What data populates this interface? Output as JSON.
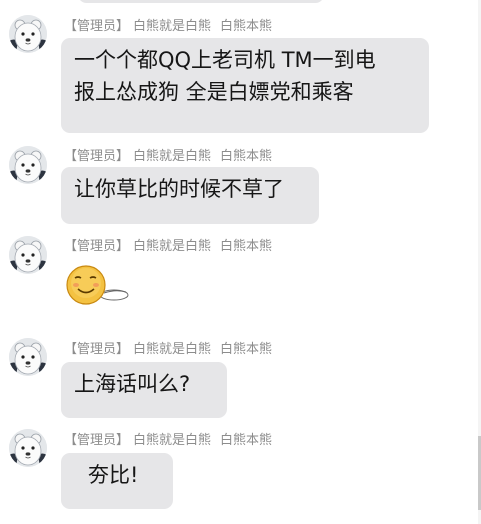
{
  "messages": [
    {
      "role": "【管理员】",
      "nickname": "白熊就是白熊",
      "title_tag": "白熊本熊",
      "text_lines": [
        "一个个都QQ上老司机  TM一到电",
        "报上怂成狗 全是白嫖党和乘客"
      ]
    },
    {
      "role": "【管理员】",
      "nickname": "白熊就是白熊",
      "title_tag": "白熊本熊",
      "text": "让你草比的时候不草了"
    },
    {
      "role": "【管理员】",
      "nickname": "白熊就是白熊",
      "title_tag": "白熊本熊",
      "sticker": "smiley-lying-down-emoji"
    },
    {
      "role": "【管理员】",
      "nickname": "白熊就是白熊",
      "title_tag": "白熊本熊",
      "text": "上海话叫么?"
    },
    {
      "role": "【管理员】",
      "nickname": "白熊就是白熊",
      "title_tag": "白熊本熊",
      "text": "夯比!"
    }
  ],
  "avatar_icon": "polar-bear-avatar-icon",
  "colors": {
    "bubble": "#e6e6e8",
    "meta_text": "#8d8d8d",
    "message_text": "#161616",
    "sticker_face": "#f4c242"
  }
}
